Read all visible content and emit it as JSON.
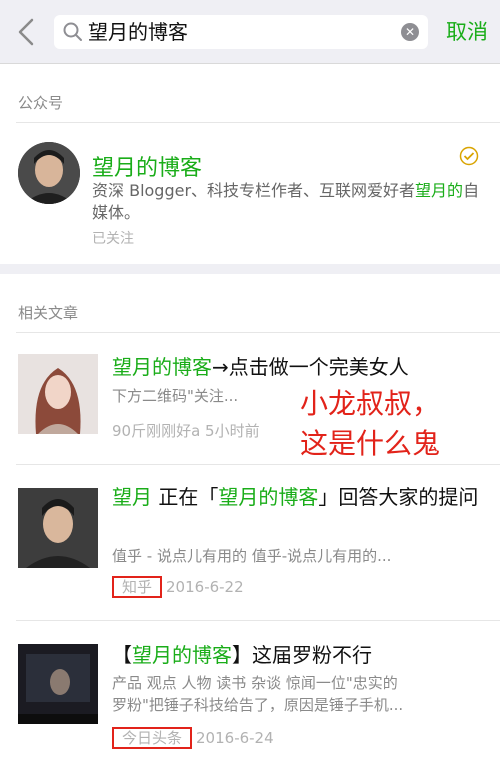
{
  "header": {
    "search_query": "望月的博客",
    "cancel_label": "取消"
  },
  "accounts_section": {
    "title": "公众号",
    "account": {
      "name": "望月的博客",
      "desc_prefix": "资深 Blogger、科技专栏作者、互联网爱好者",
      "desc_highlight": "望月的",
      "desc_suffix": "自媒体。",
      "status": "已关注"
    }
  },
  "articles_section": {
    "title": "相关文章",
    "items": [
      {
        "title_highlight": "望月的博客",
        "title_rest": "→点击做一个完美女人",
        "desc": "下方二维码\"关注...",
        "meta": "90斤刚刚好a 5小时前"
      },
      {
        "title_highlight_1": "望月",
        "title_mid": " 正在「",
        "title_highlight_2": "望月的博客",
        "title_rest": "」回答大家的提问",
        "desc": "值乎 - 说点儿有用的 值乎-说点儿有用的...",
        "source": "知乎",
        "date": "2016-6-22"
      },
      {
        "title_prefix": "【",
        "title_highlight": "望月的博客",
        "title_rest": "】这届罗粉不行",
        "desc_line1": "产品 观点 人物 读书 杂谈 惊闻一位\"忠实的",
        "desc_line2": "罗粉\"把锤子科技给告了，原因是锤子手机...",
        "source": "今日头条",
        "date": "2016-6-24"
      }
    ]
  },
  "annotation": {
    "line1": "小龙叔叔，",
    "line2": "这是什么鬼"
  },
  "colors": {
    "accent": "#1aad19",
    "annotation_red": "#e2231a",
    "background": "#efeff4"
  }
}
